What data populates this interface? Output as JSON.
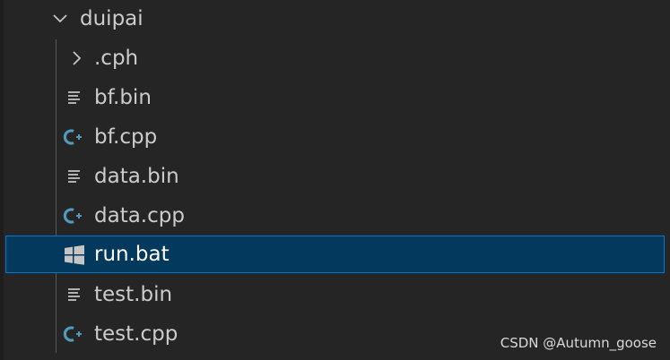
{
  "explorer": {
    "folder": {
      "name": "duipai",
      "expanded": true,
      "icon": "chevron-down-icon"
    },
    "items": [
      {
        "label": ".cph",
        "type": "folder",
        "icon": "chevron-right-icon"
      },
      {
        "label": "bf.bin",
        "type": "file",
        "icon": "lines-file-icon"
      },
      {
        "label": "bf.cpp",
        "type": "file",
        "icon": "cpp-file-icon"
      },
      {
        "label": "data.bin",
        "type": "file",
        "icon": "lines-file-icon"
      },
      {
        "label": "data.cpp",
        "type": "file",
        "icon": "cpp-file-icon"
      },
      {
        "label": "run.bat",
        "type": "file",
        "icon": "windows-file-icon",
        "selected": true
      },
      {
        "label": "test.bin",
        "type": "file",
        "icon": "lines-file-icon"
      },
      {
        "label": "test.cpp",
        "type": "file",
        "icon": "cpp-file-icon"
      }
    ]
  },
  "colors": {
    "background": "#252526",
    "selection_background": "#04395e",
    "selection_border": "#0078d4",
    "cpp_icon": "#519aba",
    "text": "#cccccc"
  },
  "watermark": "CSDN @Autumn_goose"
}
